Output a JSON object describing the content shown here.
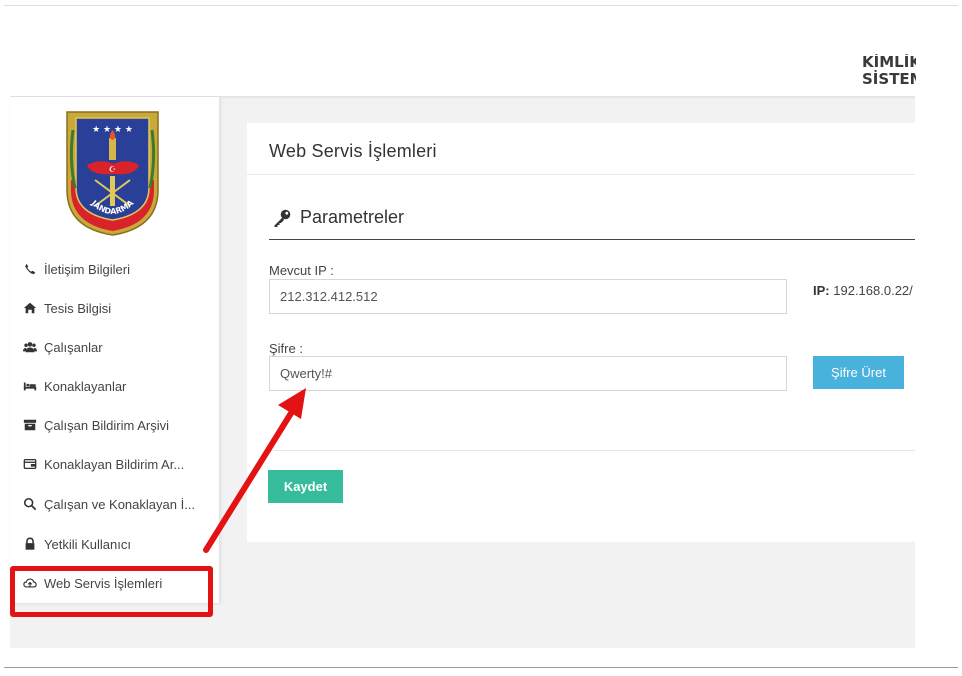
{
  "header": {
    "brand_line1": "KİMLİK",
    "brand_line2": "SİSTEMİ"
  },
  "sidebar": {
    "logo_text": "JANDARMA",
    "items": [
      {
        "label": "İletişim Bilgileri",
        "icon": "phone-icon"
      },
      {
        "label": "Tesis Bilgisi",
        "icon": "home-icon"
      },
      {
        "label": "Çalışanlar",
        "icon": "users-icon"
      },
      {
        "label": "Konaklayanlar",
        "icon": "bed-icon"
      },
      {
        "label": "Çalışan Bildirim Arşivi",
        "icon": "archive-icon"
      },
      {
        "label": "Konaklayan Bildirim Ar...",
        "icon": "wallet-icon"
      },
      {
        "label": "Çalışan ve Konaklayan İ...",
        "icon": "search-icon"
      },
      {
        "label": "Yetkili Kullanıcı",
        "icon": "lock-icon"
      },
      {
        "label": "Web Servis İşlemleri",
        "icon": "cloud-upload-icon"
      }
    ]
  },
  "main": {
    "title": "Web Servis İşlemleri",
    "section_title": "Parametreler",
    "current_ip_label": "Mevcut IP :",
    "current_ip_value": "212.312.412.512",
    "ip_label": "IP:",
    "ip_value": "192.168.0.22/",
    "password_label": "Şifre :",
    "password_value": "Qwerty!#",
    "generate_button": "Şifre Üret",
    "save_button": "Kaydet"
  },
  "colors": {
    "annotation_red": "#e41313",
    "button_info": "#48b1dc",
    "button_success": "#37bc9b"
  }
}
